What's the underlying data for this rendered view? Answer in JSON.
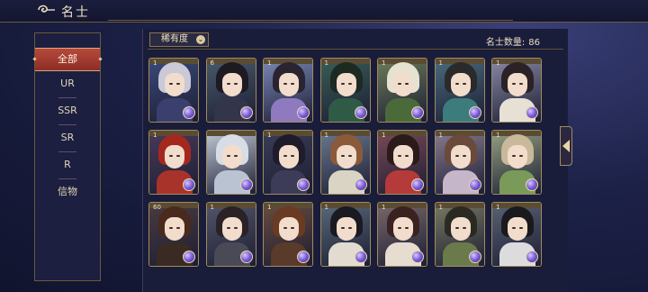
{
  "header": {
    "title": "名士"
  },
  "sidebar": {
    "items": [
      {
        "label": "全部",
        "active": true
      },
      {
        "label": "UR"
      },
      {
        "label": "SSR"
      },
      {
        "label": "SR"
      },
      {
        "label": "R"
      },
      {
        "label": "信物"
      }
    ]
  },
  "filter": {
    "rarity_label": "稀有度"
  },
  "count": {
    "label": "名士数量:",
    "value": "86"
  },
  "cards": [
    {
      "row": 0,
      "col": 0,
      "level": "1",
      "hair": "#c9c9d8",
      "robe": "#3a3f6e",
      "bg": "#3b4a7a"
    },
    {
      "row": 0,
      "col": 1,
      "level": "6",
      "hair": "#1e1a22",
      "robe": "#33354a",
      "bg": "#4a5a6c"
    },
    {
      "row": 0,
      "col": 2,
      "level": "1",
      "hair": "#2a2330",
      "robe": "#8f7ac0",
      "bg": "#7c89b8"
    },
    {
      "row": 0,
      "col": 3,
      "level": "1",
      "hair": "#1c2a22",
      "robe": "#2f5a46",
      "bg": "#3a5e56"
    },
    {
      "row": 0,
      "col": 4,
      "level": "1",
      "hair": "#e6e2d2",
      "robe": "#4a6a3a",
      "bg": "#6d7d5a"
    },
    {
      "row": 0,
      "col": 5,
      "level": "1",
      "hair": "#2a2a2a",
      "robe": "#3d7c7c",
      "bg": "#4b6c7e"
    },
    {
      "row": 0,
      "col": 6,
      "level": "1",
      "hair": "#2a2226",
      "robe": "#e6e1d4",
      "bg": "#8a8aa6"
    },
    {
      "row": 1,
      "col": 0,
      "level": "1",
      "hair": "#a5281f",
      "robe": "#a8332a",
      "bg": "#4a3a5a"
    },
    {
      "row": 1,
      "col": 1,
      "level": "",
      "hair": "#d6dde6",
      "robe": "#b9c3d2",
      "bg": "#c2ccd8"
    },
    {
      "row": 1,
      "col": 2,
      "level": "1",
      "hair": "#1f1b2a",
      "robe": "#3d3c58",
      "bg": "#3a3d56"
    },
    {
      "row": 1,
      "col": 3,
      "level": "1",
      "hair": "#8a5a3a",
      "robe": "#d9d4c4",
      "bg": "#6a7a90"
    },
    {
      "row": 1,
      "col": 4,
      "level": "1",
      "hair": "#2a1a1a",
      "robe": "#b53a3a",
      "bg": "#7a4a56"
    },
    {
      "row": 1,
      "col": 5,
      "level": "1",
      "hair": "#6a4a3a",
      "robe": "#c5b7c9",
      "bg": "#8a7c90"
    },
    {
      "row": 1,
      "col": 6,
      "level": "1",
      "hair": "#c9b89a",
      "robe": "#7a9a5a",
      "bg": "#96a282"
    },
    {
      "row": 2,
      "col": 0,
      "level": "60",
      "hair": "#4a2a1c",
      "robe": "#3a2a24",
      "bg": "#4a3c40"
    },
    {
      "row": 2,
      "col": 1,
      "level": "1",
      "hair": "#2a2226",
      "robe": "#4a4a56",
      "bg": "#54566c"
    },
    {
      "row": 2,
      "col": 2,
      "level": "1",
      "hair": "#6a3a22",
      "robe": "#5a3a2a",
      "bg": "#6a4c3e"
    },
    {
      "row": 2,
      "col": 3,
      "level": "1",
      "hair": "#1a1a22",
      "robe": "#e2dcd0",
      "bg": "#5a6a7a"
    },
    {
      "row": 2,
      "col": 4,
      "level": "1",
      "hair": "#3a2220",
      "robe": "#e6ddd0",
      "bg": "#7a6a6a"
    },
    {
      "row": 2,
      "col": 5,
      "level": "1",
      "hair": "#2a2a22",
      "robe": "#6a7a4a",
      "bg": "#7a7a62"
    },
    {
      "row": 2,
      "col": 6,
      "level": "1",
      "hair": "#1a1a1e",
      "robe": "#dcdcde",
      "bg": "#5a6474"
    }
  ]
}
